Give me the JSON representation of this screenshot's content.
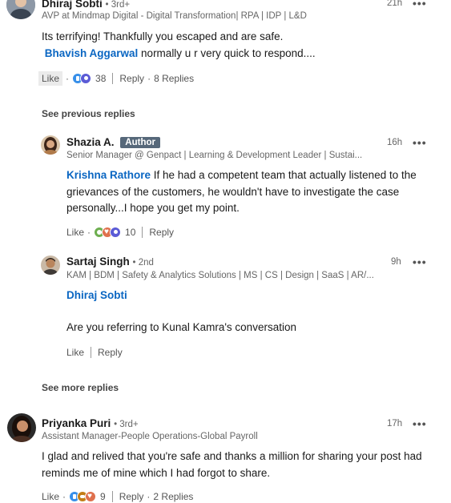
{
  "comments": {
    "dhiraj": {
      "name": "Dhiraj Sobti",
      "degree": "• 3rd+",
      "headline": "AVP at Mindmap Digital - Digital Transformation| RPA | IDP | L&D",
      "time": "21h",
      "text_1": "Its terrifying! Thankfully you escaped and are safe.",
      "mention": "Bhavish Aggarwal",
      "text_2": " normally u r very quick to respond....",
      "like_label": "Like",
      "reaction_count": "38",
      "reply_label": "Reply",
      "replies_count": "8 Replies",
      "reaction_icons": [
        "like-icon",
        "insight-icon"
      ]
    },
    "see_previous_replies": "See previous replies",
    "shazia": {
      "name": "Shazia A.",
      "badge": "Author",
      "headline": "Senior Manager @ Genpact | Learning & Development Leader | Sustai...",
      "time": "16h",
      "mention": "Krishna Rathore",
      "text": " If he had a competent team that actually listened to the grievances of the customers, he wouldn't have to investigate the case personally...I hope you get my point.",
      "like_label": "Like",
      "reaction_count": "10",
      "reply_label": "Reply",
      "reaction_icons": [
        "clap-icon",
        "love-icon",
        "insight-icon"
      ]
    },
    "sartaj": {
      "name": "Sartaj Singh",
      "degree": "• 2nd",
      "headline": "KAM | BDM | Safety & Analytics Solutions | MS | CS | Design | SaaS | AR/...",
      "time": "9h",
      "mention": "Dhiraj Sobti",
      "text": "Are you referring to Kunal Kamra's conversation",
      "like_label": "Like",
      "reply_label": "Reply"
    },
    "see_more_replies": "See more replies",
    "priyanka": {
      "name": "Priyanka Puri",
      "degree": "• 3rd+",
      "headline": "Assistant Manager-People Operations-Global Payroll",
      "time": "17h",
      "text": "I glad and relived that you're safe and thanks a million for sharing your post had reminds me of mine which I had forgot to share.",
      "like_label": "Like",
      "reaction_count": "9",
      "reply_label": "Reply",
      "replies_count": "2 Replies",
      "reaction_icons": [
        "like-icon",
        "support-icon",
        "love-icon"
      ]
    }
  },
  "more_label": "•••",
  "colors": {
    "mention": "#0a66c2",
    "badge": "#56687a"
  }
}
